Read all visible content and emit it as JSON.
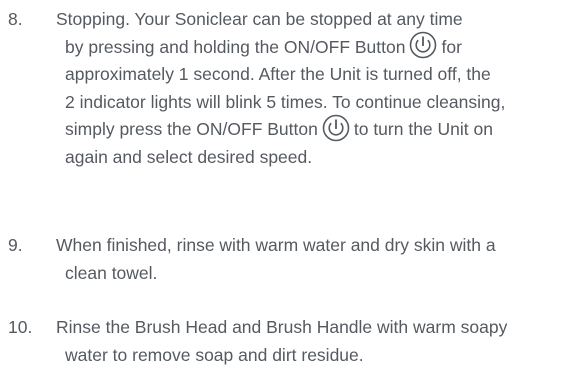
{
  "steps": [
    {
      "number": "8.",
      "lines": [
        "Stopping. Your Soniclear can be stopped at any time",
        "by pressing and holding the ON/OFF Button",
        "for",
        "approximately 1 second. After the Unit is turned off, the",
        "2 indicator lights will blink 5 times. To continue cleansing,",
        "simply press the ON/OFF Button",
        "to turn the Unit on",
        "again and select desired speed."
      ]
    },
    {
      "number": "9.",
      "lines": [
        "When finished, rinse with warm water and dry skin with a",
        "clean towel."
      ]
    },
    {
      "number": "10.",
      "lines": [
        "Rinse the Brush Head and Brush Handle with warm soapy",
        "water to remove soap and dirt residue."
      ]
    }
  ],
  "icons": {
    "power_button": "power-icon"
  },
  "colors": {
    "text": "#555a60",
    "icon": "#555a60",
    "background": "#ffffff"
  }
}
